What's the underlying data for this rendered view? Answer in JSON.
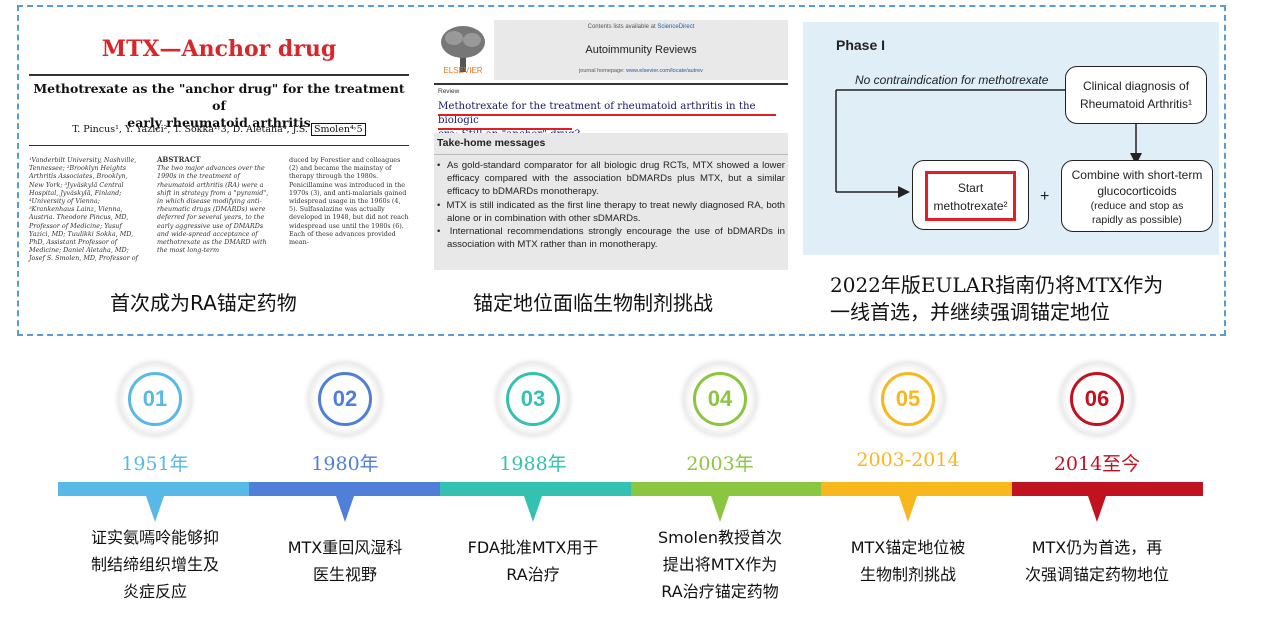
{
  "top": {
    "panel1": {
      "title": "MTX—Anchor drug",
      "paper_title_line1": "Methotrexate as the \"anchor drug\" for the treatment of",
      "paper_title_line2": "early rheumatoid arthritis",
      "authors": "T. Pincus¹, Y. Yazici², T. Sokka¹˒3, D. Aletaha⁴, J.S.",
      "author_highlight": "Smolen⁴˒5",
      "affiliations": "¹Vanderbilt University, Nashville, Tennessee; ²Brooklyn Heights Arthritis Associates, Brooklyn, New York; ³Jyväskylä Central Hospital, Jyväskylä, Finland; ⁴University of Vienna; ⁵Krankenhaus Lainz, Vienna, Austria. Theodore Pincus, MD, Professor of Medicine; Yusuf Yazici, MD; Tuulikki Sokka, MD, PhD, Assistant Professor of Medicine; Daniel Aletaha, MD; Josef S. Smolen, MD, Professor of Medicine.",
      "abstract_heading": "ABSTRACT",
      "abstract_text": "The two major advances over the 1990s in the treatment of rheumatoid arthritis (RA) were a shift in strategy from a \"pyramid\", in which disease modifying anti-rheumatic drugs (DMARDs) were deferred for several years, to the early aggressive use of DMARDs and wide-spread acceptance of methotrexate as the DMARD with the most long-term",
      "col3_text": "duced by Forestier and colleagues (2) and became the mainstay of therapy through the 1980s. Penicillamine was introduced in the 1970s (3), and anti-malarials gained widespread usage in the 1960s (4, 5). Sulfasalazine was actually developed in 1948, but did not reach widespread use until the 1980s (6). Each of these advances provided mean-",
      "caption": "首次成为RA锚定药物"
    },
    "panel2": {
      "contents_prefix": "Contents lists available at ",
      "contents_link": "ScienceDirect",
      "journal": "Autoimmunity Reviews",
      "homepage_prefix": "journal homepage: ",
      "homepage_url": "www.elsevier.com/locate/autrev",
      "publisher": "ELSEVIER",
      "article_type": "Review",
      "article_title_line1": "Methotrexate for the treatment of rheumatoid arthritis in the biologic",
      "article_title_line2": "era: Still an \"anchor\" drug?",
      "messages_heading": "Take-home messages",
      "bullets": [
        "As gold-standard comparator for all biologic drug RCTs, MTX showed a lower efficacy compared with the association bDMARDs plus MTX, but a similar efficacy to bDMARDs monotherapy.",
        "MTX is still indicated as the first line therapy to treat newly diagnosed RA, both alone or in combination with other sDMARDs.",
        "International recommendations strongly encourage the use of bDMARDs in association with MTX rather than in monotherapy."
      ],
      "caption": "锚定地位面临生物制剂挑战"
    },
    "panel3": {
      "phase": "Phase I",
      "no_contra": "No contraindication for methotrexate",
      "diagnosis_line1": "Clinical diagnosis of",
      "diagnosis_line2": "Rheumatoid Arthritis¹",
      "start_line1": "Start",
      "start_line2": "methotrexate²",
      "plus": "+",
      "combine_line1": "Combine with short-term",
      "combine_line2": "glucocorticoids",
      "combine_line3": "(reduce and stop as",
      "combine_line4": "rapidly as possible)",
      "caption_line1": "2022年版EULAR指南仍将MTX作为",
      "caption_line2": "一线首选，并继续强调锚定地位"
    }
  },
  "timeline": [
    {
      "num": "01",
      "year": "1951年",
      "color": "#58b8e8",
      "desc": [
        "证实氨嘕呤能够抑",
        "制结缔组织增生及",
        "炎症反应"
      ]
    },
    {
      "num": "02",
      "year": "1980年",
      "color": "#4f7fd8",
      "desc": [
        "MTX重回风湿科",
        "医生视野"
      ]
    },
    {
      "num": "03",
      "year": "1988年",
      "color": "#33c1b1",
      "desc": [
        "FDA批准MTX用于",
        "RA治疗"
      ]
    },
    {
      "num": "04",
      "year": "2003年",
      "color": "#8ac640",
      "desc": [
        "Smolen教授首次",
        "提出将MTX作为",
        "RA治疗锚定药物"
      ]
    },
    {
      "num": "05",
      "year": "2003-2014",
      "color": "#f7b71d",
      "desc": [
        "MTX锚定地位被",
        "生物制剂挑战"
      ]
    },
    {
      "num": "06",
      "year": "2014至今",
      "color": "#c1121f",
      "desc": [
        "MTX仍为首选，再",
        "次强调锚定药物地位"
      ]
    }
  ]
}
